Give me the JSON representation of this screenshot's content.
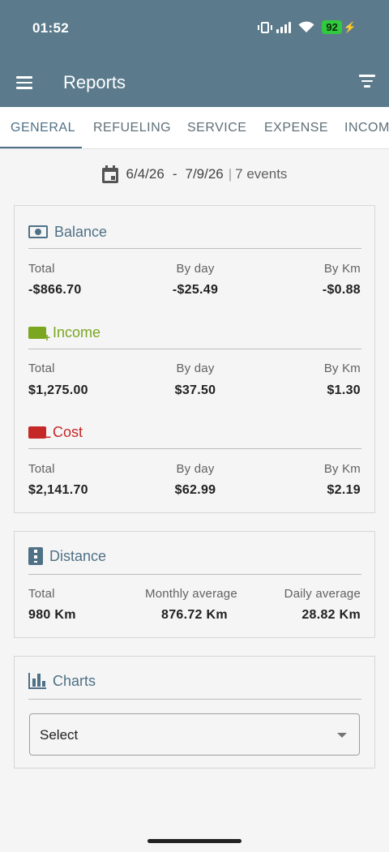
{
  "status_bar": {
    "time": "01:52",
    "battery": "92"
  },
  "app_bar": {
    "title": "Reports"
  },
  "tabs": [
    {
      "label": "GENERAL"
    },
    {
      "label": "REFUELING"
    },
    {
      "label": "SERVICE"
    },
    {
      "label": "EXPENSE"
    },
    {
      "label": "INCOM"
    }
  ],
  "date_range": {
    "start": "6/4/26",
    "dash": "-",
    "end": "7/9/26",
    "separator": "|",
    "events": "7 events"
  },
  "balance": {
    "title": "Balance",
    "total_label": "Total",
    "total": "-$866.70",
    "day_label": "By day",
    "day": "-$25.49",
    "km_label": "By Km",
    "km": "-$0.88"
  },
  "income": {
    "title": "Income",
    "total_label": "Total",
    "total": "$1,275.00",
    "day_label": "By day",
    "day": "$37.50",
    "km_label": "By Km",
    "km": "$1.30"
  },
  "cost": {
    "title": "Cost",
    "total_label": "Total",
    "total": "$2,141.70",
    "day_label": "By day",
    "day": "$62.99",
    "km_label": "By Km",
    "km": "$2.19"
  },
  "distance": {
    "title": "Distance",
    "total_label": "Total",
    "total": "980 Km",
    "monthly_label": "Monthly average",
    "monthly": "876.72 Km",
    "daily_label": "Daily average",
    "daily": "28.82 Km"
  },
  "charts": {
    "title": "Charts",
    "select_value": "Select"
  },
  "colors": {
    "primary": "#5b7b8c",
    "accent": "#4f7186",
    "income": "#7aa620",
    "cost": "#c62828",
    "battery": "#31c93d"
  }
}
